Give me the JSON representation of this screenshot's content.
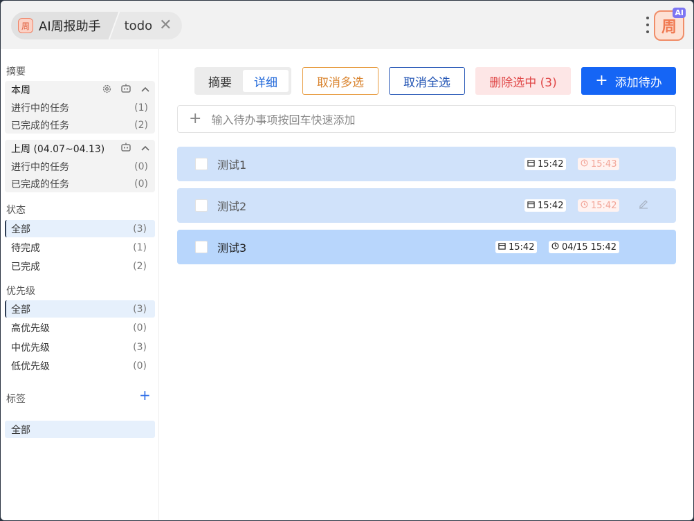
{
  "header": {
    "app_badge": "周",
    "app_title": "AI周报助手",
    "tab_title": "todo",
    "close_glyph": "✕",
    "logo_text": "周",
    "logo_badge": "AI"
  },
  "sidebar": {
    "summary_title": "摘要",
    "this_week": {
      "title": "本周",
      "icons": [
        "gear-icon",
        "robot-icon",
        "chevron-up-icon"
      ],
      "rows": [
        {
          "label": "进行中的任务",
          "count": "(1)"
        },
        {
          "label": "已完成的任务",
          "count": "(2)"
        }
      ]
    },
    "last_week": {
      "title": "上周 (04.07~04.13)",
      "icons": [
        "robot-icon",
        "chevron-up-icon"
      ],
      "rows": [
        {
          "label": "进行中的任务",
          "count": "(0)"
        },
        {
          "label": "已完成的任务",
          "count": "(0)"
        }
      ]
    },
    "status_title": "状态",
    "status": [
      {
        "label": "全部",
        "count": "(3)",
        "active": true
      },
      {
        "label": "待完成",
        "count": "(1)"
      },
      {
        "label": "已完成",
        "count": "(2)"
      }
    ],
    "priority_title": "优先级",
    "priority": [
      {
        "label": "全部",
        "count": "(3)",
        "active": true
      },
      {
        "label": "高优先级",
        "count": "(0)"
      },
      {
        "label": "中优先级",
        "count": "(3)"
      },
      {
        "label": "低优先级",
        "count": "(0)"
      }
    ],
    "tags_title": "标签",
    "tags_add": "+",
    "tags_all": "全部"
  },
  "toolbar": {
    "view_summary": "摘要",
    "view_detail": "详细",
    "cancel_multi": "取消多选",
    "cancel_all": "取消全选",
    "delete_selected": "删除选中 (3)",
    "add_todo": "添加待办",
    "add_plus": "+"
  },
  "quick_add": {
    "plus": "+",
    "placeholder": "输入待办事项按回车快速添加"
  },
  "todos": [
    {
      "title": "测试1",
      "created": "15:42",
      "due": "15:43",
      "due_overdue": true
    },
    {
      "title": "测试2",
      "created": "15:42",
      "due": "15:42",
      "due_overdue": true
    },
    {
      "title": "测试3",
      "created": "15:42",
      "due": "04/15 15:42",
      "due_overdue": false
    }
  ],
  "colors": {
    "primary": "#1565f5",
    "danger": "#e04848",
    "warning": "#d9822b",
    "row_bg": "#d0e2fa",
    "row_bg_selected": "#b8d6fc"
  }
}
